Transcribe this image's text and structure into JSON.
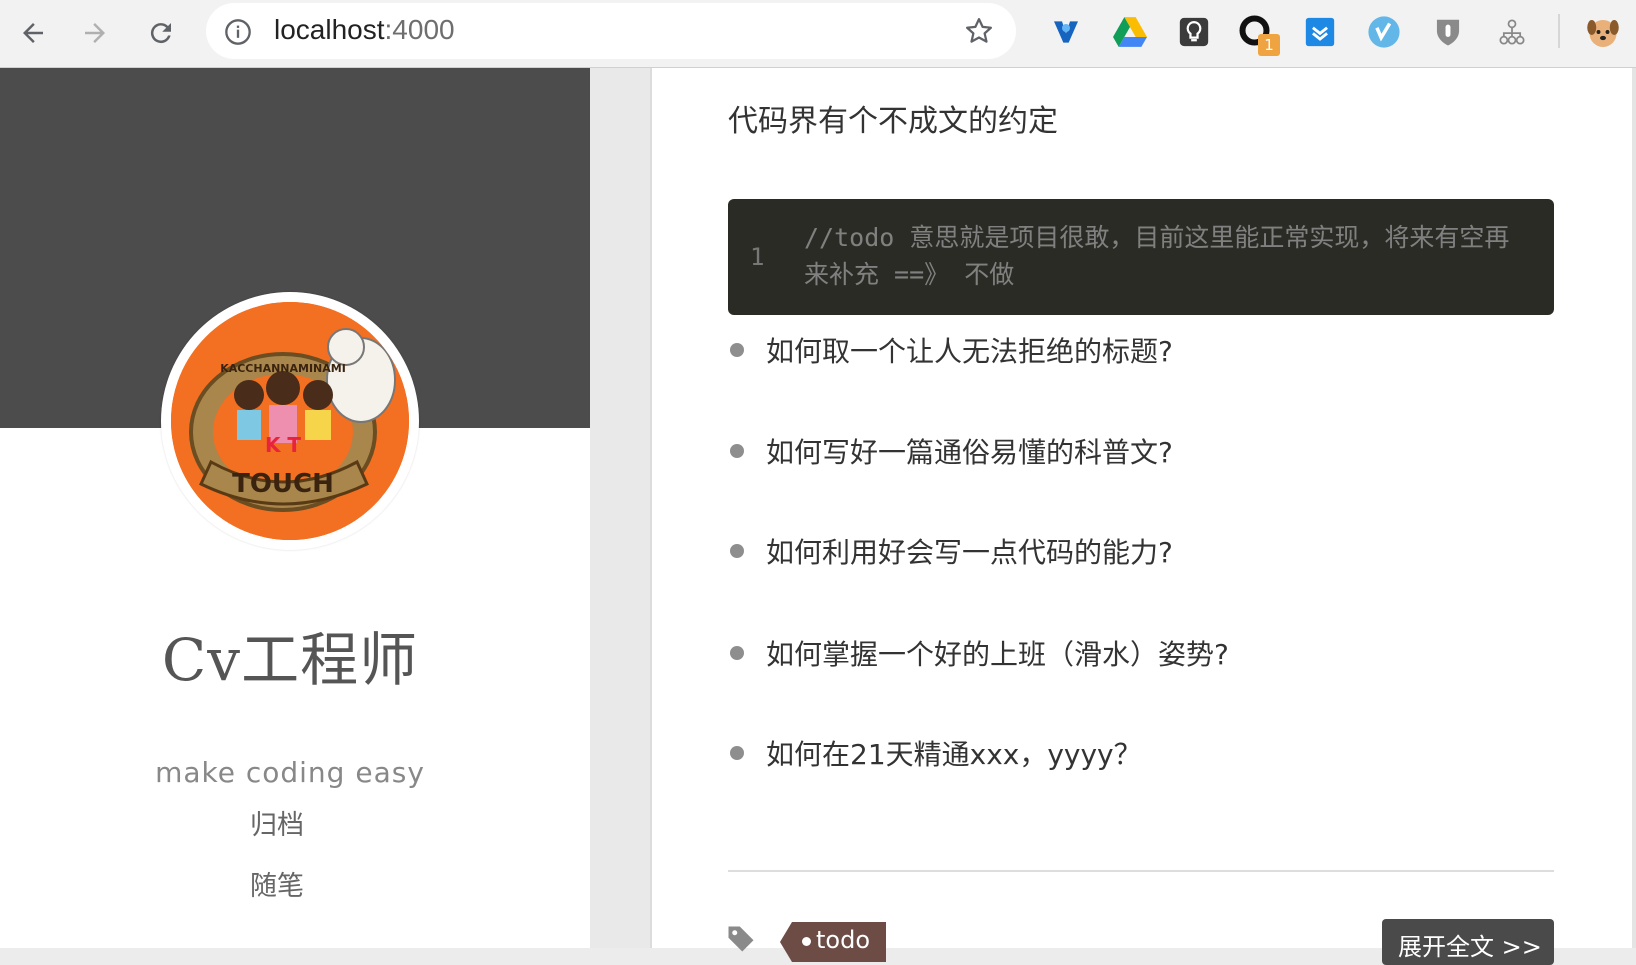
{
  "browser": {
    "back_label": "back",
    "forward_label": "forward",
    "reload_label": "reload",
    "url_host": "localhost",
    "url_port": ":4000",
    "extensions": [
      "vivaldi-like-icon",
      "google-drive-icon",
      "lightbulb-icon",
      "circle-badge-icon",
      "pocket-like-icon",
      "vimeo-like-icon",
      "shield-icon",
      "sitemap-icon",
      "profile-avatar-icon"
    ],
    "badge_count": "1"
  },
  "sidebar": {
    "title": "Cv工程师",
    "subtitle": "make coding easy",
    "nav": [
      {
        "label": "归档"
      },
      {
        "label": "随笔"
      }
    ],
    "avatar_text": "TOUCH",
    "avatar_arc_text": "KACCHANNAMINAMI",
    "avatar_letters": "K T"
  },
  "post": {
    "intro": "代码界有个不成文的约定",
    "code": {
      "line_number": "1",
      "text": "//todo 意思就是项目很敢，目前这里能正常实现，将来有空再来补充 ==》 不做"
    },
    "list": [
      {
        "text": "如何取一个让人无法拒绝的标题?"
      },
      {
        "text": "如何写好一篇通俗易懂的科普文?"
      },
      {
        "text": "如何利用好会写一点代码的能力?"
      },
      {
        "text": "如何掌握一个好的上班（滑水）姿势?"
      },
      {
        "text": "如何在21天精通xxx，yyyy？"
      }
    ],
    "tag": "todo",
    "read_more": "展开全文 >>"
  },
  "colors": {
    "banner": "#4c4c4c",
    "avatar_bg": "#f36f21",
    "code_bg": "#2b2b26",
    "tag_bg": "#6e4c46",
    "button_bg": "#4a4a4a"
  }
}
